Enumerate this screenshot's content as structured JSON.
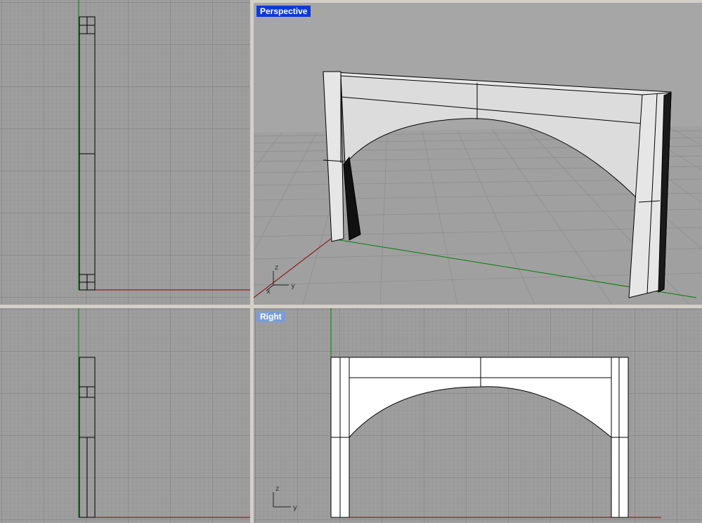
{
  "viewports": {
    "top_left": {
      "title": ""
    },
    "perspective": {
      "title": "Perspective",
      "active": true
    },
    "bottom_left": {
      "title": ""
    },
    "right": {
      "title": "Right",
      "active": false
    }
  },
  "axis_labels": {
    "x": "x",
    "y": "y",
    "z": "z"
  },
  "colors": {
    "background": "#9e9e9e",
    "grid_minor": "#8c8c8c",
    "grid_major": "#7a7a7a",
    "x_axis": "#8b0000",
    "y_axis": "#008000",
    "active_title": "#0a3bd6",
    "inactive_title": "#7b9cd8"
  }
}
